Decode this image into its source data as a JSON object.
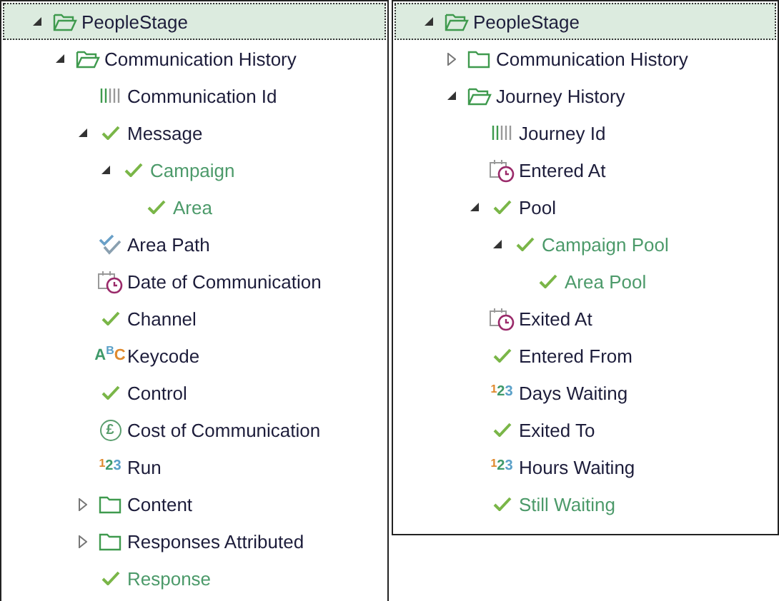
{
  "panels": [
    {
      "tree": [
        {
          "label": "PeopleStage",
          "kind": "folder",
          "expanded": true,
          "selected": true,
          "accent": false,
          "children": [
            {
              "label": "Communication History",
              "kind": "folder",
              "expanded": true,
              "selected": false,
              "accent": false,
              "children": [
                {
                  "label": "Communication Id",
                  "kind": "id",
                  "selected": false,
                  "accent": false
                },
                {
                  "label": "Message",
                  "kind": "check",
                  "expanded": true,
                  "selected": false,
                  "accent": false,
                  "children": [
                    {
                      "label": "Campaign",
                      "kind": "check",
                      "expanded": true,
                      "selected": false,
                      "accent": true,
                      "children": [
                        {
                          "label": "Area",
                          "kind": "check",
                          "selected": false,
                          "accent": true
                        }
                      ]
                    }
                  ]
                },
                {
                  "label": "Area Path",
                  "kind": "multi",
                  "selected": false,
                  "accent": false
                },
                {
                  "label": "Date of Communication",
                  "kind": "date",
                  "selected": false,
                  "accent": false
                },
                {
                  "label": "Channel",
                  "kind": "check",
                  "selected": false,
                  "accent": false
                },
                {
                  "label": "Keycode",
                  "kind": "text",
                  "glyph": "ABC",
                  "selected": false,
                  "accent": false
                },
                {
                  "label": "Control",
                  "kind": "check",
                  "selected": false,
                  "accent": false
                },
                {
                  "label": "Cost of Communication",
                  "kind": "currency",
                  "glyph": "£",
                  "selected": false,
                  "accent": false
                },
                {
                  "label": "Run",
                  "kind": "number",
                  "glyph": "123",
                  "selected": false,
                  "accent": false
                },
                {
                  "label": "Content",
                  "kind": "folder",
                  "expanded": false,
                  "selected": false,
                  "accent": false
                },
                {
                  "label": "Responses Attributed",
                  "kind": "folder",
                  "expanded": false,
                  "selected": false,
                  "accent": false
                },
                {
                  "label": "Response",
                  "kind": "check",
                  "selected": false,
                  "accent": true
                }
              ]
            }
          ]
        }
      ]
    },
    {
      "tree": [
        {
          "label": "PeopleStage",
          "kind": "folder",
          "expanded": true,
          "selected": true,
          "accent": false,
          "children": [
            {
              "label": "Communication History",
              "kind": "folder",
              "expanded": false,
              "selected": false,
              "accent": false
            },
            {
              "label": "Journey History",
              "kind": "folder",
              "expanded": true,
              "selected": false,
              "accent": false,
              "children": [
                {
                  "label": "Journey Id",
                  "kind": "id",
                  "selected": false,
                  "accent": false
                },
                {
                  "label": "Entered At",
                  "kind": "date",
                  "selected": false,
                  "accent": false
                },
                {
                  "label": "Pool",
                  "kind": "check",
                  "expanded": true,
                  "selected": false,
                  "accent": false,
                  "children": [
                    {
                      "label": "Campaign Pool",
                      "kind": "check",
                      "expanded": true,
                      "selected": false,
                      "accent": true,
                      "children": [
                        {
                          "label": "Area Pool",
                          "kind": "check",
                          "selected": false,
                          "accent": true
                        }
                      ]
                    }
                  ]
                },
                {
                  "label": "Exited At",
                  "kind": "date",
                  "selected": false,
                  "accent": false
                },
                {
                  "label": "Entered From",
                  "kind": "check",
                  "selected": false,
                  "accent": false
                },
                {
                  "label": "Days Waiting",
                  "kind": "number",
                  "glyph": "123",
                  "selected": false,
                  "accent": false
                },
                {
                  "label": "Exited To",
                  "kind": "check",
                  "selected": false,
                  "accent": false
                },
                {
                  "label": "Hours Waiting",
                  "kind": "number",
                  "glyph": "123",
                  "selected": false,
                  "accent": false
                },
                {
                  "label": "Still Waiting",
                  "kind": "check",
                  "selected": false,
                  "accent": true
                }
              ]
            }
          ]
        }
      ]
    }
  ]
}
